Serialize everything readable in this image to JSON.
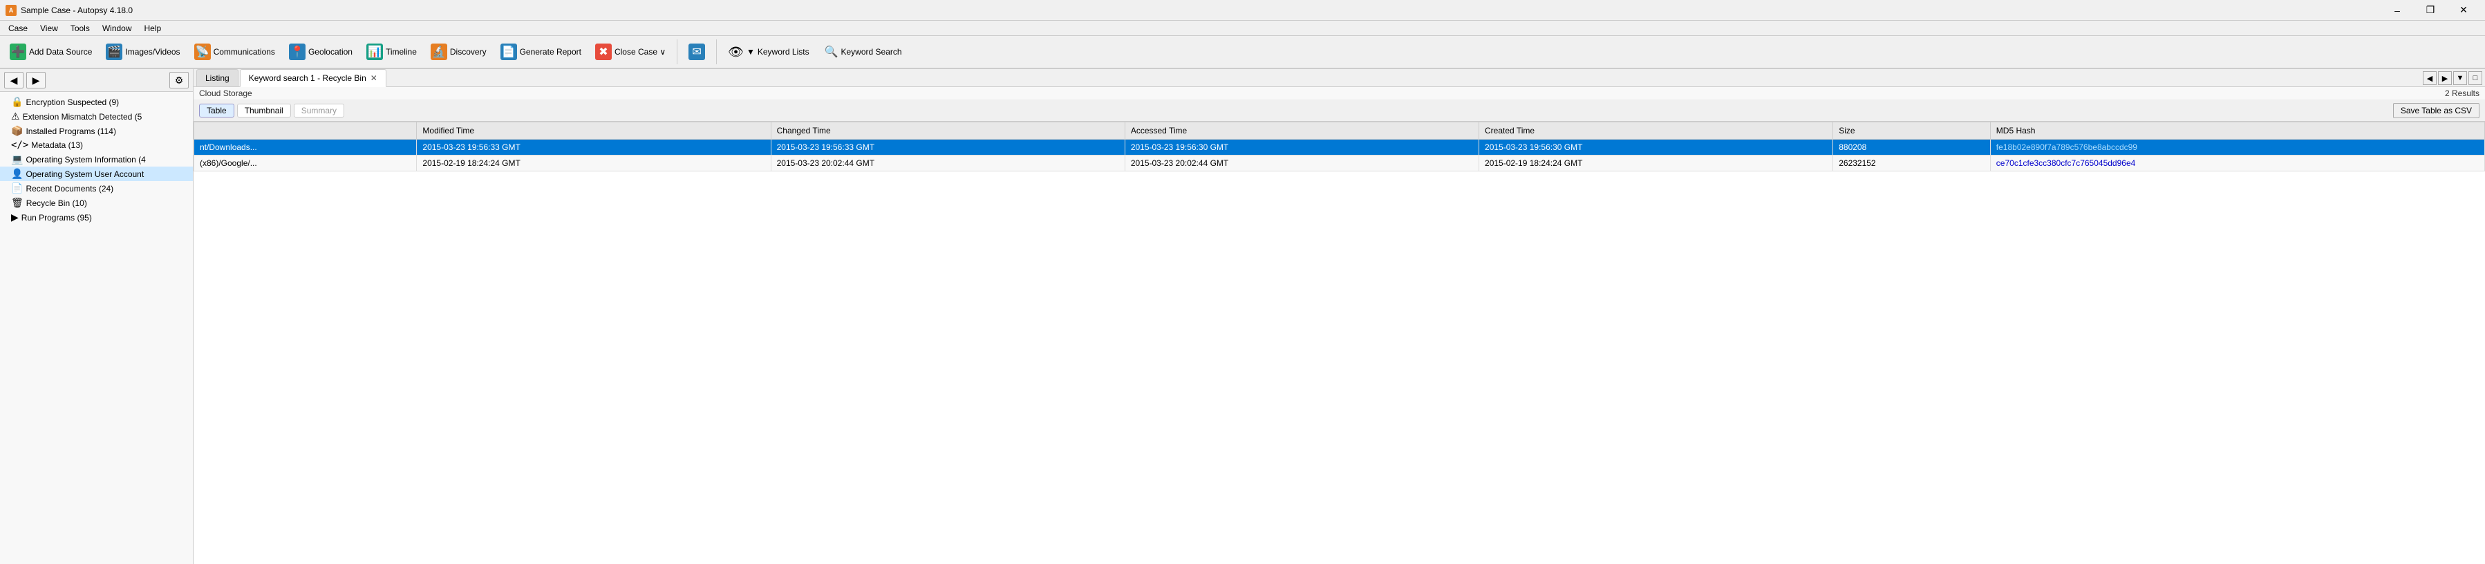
{
  "titleBar": {
    "title": "Sample Case - Autopsy 4.18.0",
    "controls": [
      "–",
      "❐",
      "✕"
    ]
  },
  "menuBar": {
    "items": [
      "Case",
      "View",
      "Tools",
      "Window",
      "Help"
    ]
  },
  "toolbar": {
    "buttons": [
      {
        "id": "add-data-source",
        "label": "Add Data Source",
        "icon": "➕",
        "iconClass": "icon-green"
      },
      {
        "id": "images-videos",
        "label": "Images/Videos",
        "icon": "🎬",
        "iconClass": "icon-blue"
      },
      {
        "id": "communications",
        "label": "Communications",
        "icon": "📡",
        "iconClass": "icon-orange"
      },
      {
        "id": "geolocation",
        "label": "Geolocation",
        "icon": "📍",
        "iconClass": "icon-blue"
      },
      {
        "id": "timeline",
        "label": "Timeline",
        "icon": "📊",
        "iconClass": "icon-teal"
      },
      {
        "id": "discovery",
        "label": "Discovery",
        "icon": "🔬",
        "iconClass": "icon-orange"
      },
      {
        "id": "generate-report",
        "label": "Generate Report",
        "icon": "📄",
        "iconClass": "icon-blue"
      },
      {
        "id": "close-case",
        "label": "Close Case ∨",
        "icon": "✖",
        "iconClass": "icon-red"
      }
    ],
    "keywordLists": "Keyword Lists",
    "keywordSearch": "Keyword Search"
  },
  "sidebar": {
    "treeItems": [
      {
        "label": "Encryption Suspected (9)",
        "icon": "🔒"
      },
      {
        "label": "Extension Mismatch Detected (5",
        "icon": "⚠"
      },
      {
        "label": "Installed Programs (114)",
        "icon": "📦"
      },
      {
        "label": "Metadata (13)",
        "icon": "<>"
      },
      {
        "label": "Operating System Information (4",
        "icon": "💻"
      },
      {
        "label": "Operating System User Account",
        "icon": "👤",
        "selected": true
      },
      {
        "label": "Recent Documents (24)",
        "icon": "📄"
      },
      {
        "label": "Recycle Bin (10)",
        "icon": "🗑"
      },
      {
        "label": "Run Programs (95)",
        "icon": "▶"
      }
    ]
  },
  "tabs": {
    "items": [
      {
        "id": "listing",
        "label": "Listing",
        "closable": false,
        "active": false
      },
      {
        "id": "keyword-search-1",
        "label": "Keyword search 1 - Recycle Bin",
        "closable": true,
        "active": true
      }
    ]
  },
  "content": {
    "cloudStorageLabel": "Cloud Storage",
    "resultsCount": "2 Results",
    "subTabs": [
      {
        "label": "Table",
        "active": true
      },
      {
        "label": "Thumbnail",
        "active": false
      },
      {
        "label": "Summary",
        "active": false,
        "disabled": true
      }
    ],
    "saveCSVLabel": "Save Table as CSV",
    "tableHeaders": [
      "",
      "Modified Time",
      "Changed Time",
      "Accessed Time",
      "Created Time",
      "Size",
      "MD5 Hash"
    ],
    "tableRows": [
      {
        "name": "nt/Downloads...",
        "modifiedTime": "2015-03-23 19:56:33 GMT",
        "changedTime": "2015-03-23 19:56:33 GMT",
        "accessedTime": "2015-03-23 19:56:30 GMT",
        "createdTime": "2015-03-23 19:56:30 GMT",
        "size": "880208",
        "md5": "fe18b02e890f7a789c576be8abccdc99",
        "selected": true
      },
      {
        "name": "(x86)/Google/...",
        "modifiedTime": "2015-02-19 18:24:24 GMT",
        "changedTime": "2015-03-23 20:02:44 GMT",
        "accessedTime": "2015-03-23 20:02:44 GMT",
        "createdTime": "2015-02-19 18:24:24 GMT",
        "size": "26232152",
        "md5": "ce70c1cfe3cc380cfc7c765045dd96e4",
        "selected": false
      }
    ]
  }
}
